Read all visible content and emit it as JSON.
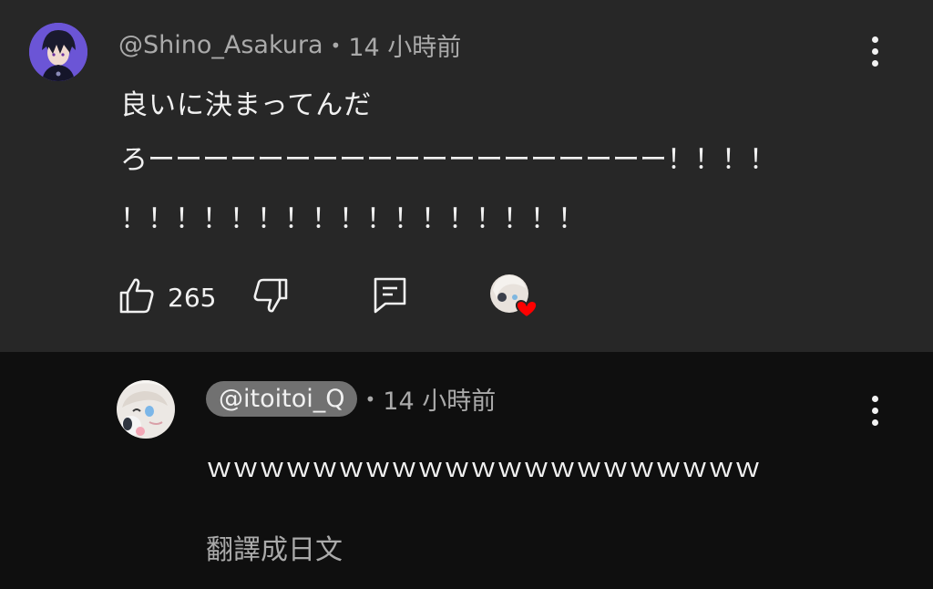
{
  "top_comment": {
    "handle": "@Shino_Asakura",
    "separator": "•",
    "time": "14 小時前",
    "text_lines": [
      "良いに決まってんだ",
      "ろーーーーーーーーーーーーーーーーーーー！！！！",
      "！！！！！！！！！！！！！！！！！"
    ],
    "likes": "265",
    "creator_heart": true
  },
  "reply": {
    "handle": "@itoitoi_Q",
    "separator": "•",
    "time": "14 小時前",
    "text": "ｗｗｗｗｗｗｗｗｗｗｗｗｗｗｗｗｗｗｗｗｗ",
    "translate_label": "翻譯成日文"
  },
  "colors": {
    "top_background": "#272727",
    "reply_background": "#0f0f0f",
    "meta_text": "#aaaaaa",
    "primary_text": "#f1f1f1",
    "heart": "#ff0000",
    "pill": "#717171"
  }
}
